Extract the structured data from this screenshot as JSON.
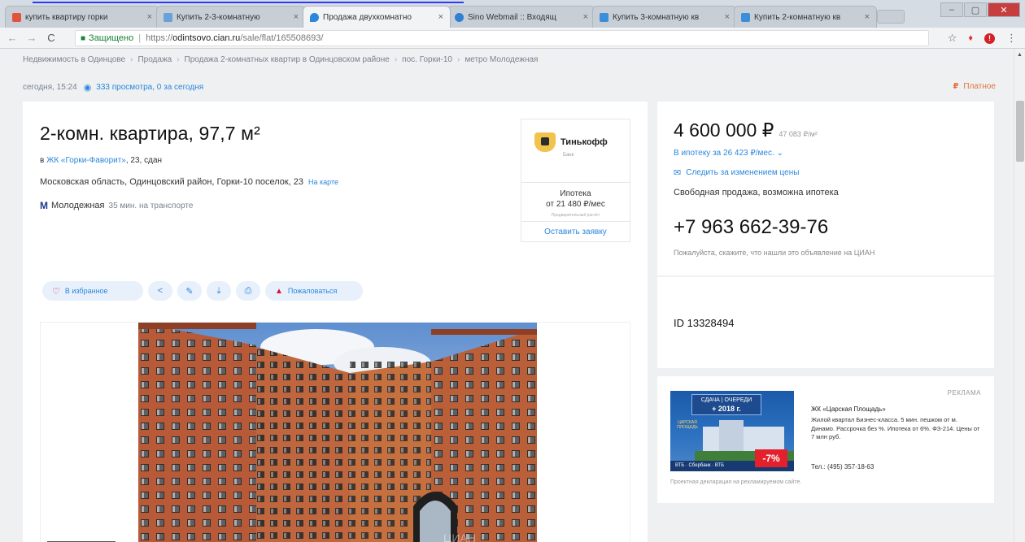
{
  "browser": {
    "tabs": [
      {
        "title": "купить квартиру горки",
        "favicon_color": "#e0533c"
      },
      {
        "title": "Купить 2-3-комнатную",
        "favicon_color": "#6aa0d8"
      },
      {
        "title": "Продажа двухкомнатно",
        "favicon_color": "#2b87db"
      },
      {
        "title": "Sino Webmail :: Входящ",
        "favicon_color": "#2f7fd4"
      },
      {
        "title": "Купить 3-комнатную кв",
        "favicon_color": "#3a8fd8"
      },
      {
        "title": "Купить 2-комнатную кв",
        "favicon_color": "#3a8fd8"
      }
    ],
    "close_glyph": "×",
    "nav": {
      "back": "←",
      "forward": "→",
      "reload": "C"
    },
    "secure_label": "Защищено",
    "url_prefix": "https://",
    "url_host": "odintsovo.cian.ru",
    "url_path": "/sale/flat/165508693/",
    "star": "☆",
    "ext_red": "♦",
    "ext_badge": "!",
    "menu": "⋮",
    "window_controls": {
      "minimize": "–",
      "maximize": "▢",
      "close": "✕"
    }
  },
  "breadcrumbs": [
    "Недвижимость в Одинцове",
    "Продажа",
    "Продажа 2-комнатных квартир в Одинцовском районе",
    "пос. Горки-10",
    "метро Молодежная"
  ],
  "breadcrumb_sep": "›",
  "meta": {
    "published": "сегодня, 15:24",
    "eye": "◉",
    "views": "333 просмотра, 0 за сегодня"
  },
  "complain": {
    "icon": "₽",
    "label": "Платное"
  },
  "listing": {
    "title": "2-комн. квартира, 97,7 м²",
    "complex_prefix": "в ",
    "complex_name": "ЖК «Горки-Фаворит»",
    "complex_suffix": ", 23, сдан",
    "address": "Московская область, Одинцовский район, Горки-10 поселок, 23",
    "on_map": "На карте",
    "metro_icon": "M",
    "metro": "Молодежная",
    "metro_distance": "35 мин. на транспорте"
  },
  "actions": {
    "favorite_icon": "♡",
    "favorite": "В избранное",
    "share_icon": "<",
    "edit_icon": "✎",
    "download_icon": "⤓",
    "print_icon": "⎙",
    "report_icon": "▲",
    "report": "Пожаловаться"
  },
  "bank": {
    "name": "Тинькофф",
    "sub": "Банк",
    "mortgage_title": "Ипотека",
    "mortgage_rate": "от 21 480 ₽/мес",
    "note": "Предварительный расчёт",
    "apply": "Оставить заявку"
  },
  "price": {
    "value": "4 600 000 ₽",
    "per_sqm": "47 083 ₽/м²",
    "mortgage": "В ипотеку за 26 423 ₽/мес.  ⌄",
    "follow_icon": "✉",
    "follow": "Следить за изменением цены",
    "sale_type": "Свободная продажа, возможна ипотека",
    "phone": "+7 963 662-39-76",
    "phone_note": "Пожалуйста, скажите, что нашли это объявление на ЦИАН"
  },
  "listing_id": "ID 13328494",
  "ad": {
    "label": "РЕКЛАМА",
    "ribbon_line1": "СДАЧА | ОЧЕРЕДИ",
    "ribbon_line2": "+ 2018 г.",
    "banner_logo": "ЦАРСКАЯ ПЛОЩАДЬ",
    "banner_strip": "ВТБ   ·   Сбербанк   ·   ВТБ",
    "banner_badge": "-7%",
    "title": "ЖК «Царская Площадь»",
    "text": "Жилой квартал Бизнес-класса. 5 мин. пешком от м. Динамо. Рассрочка без %. Ипотека от 6%. ФЗ-214. Цены от 7 млн руб.",
    "phone": "Тел.: (495) 357-18-63",
    "disclaimer": "Проектная декларация на рекламируемом сайте."
  }
}
